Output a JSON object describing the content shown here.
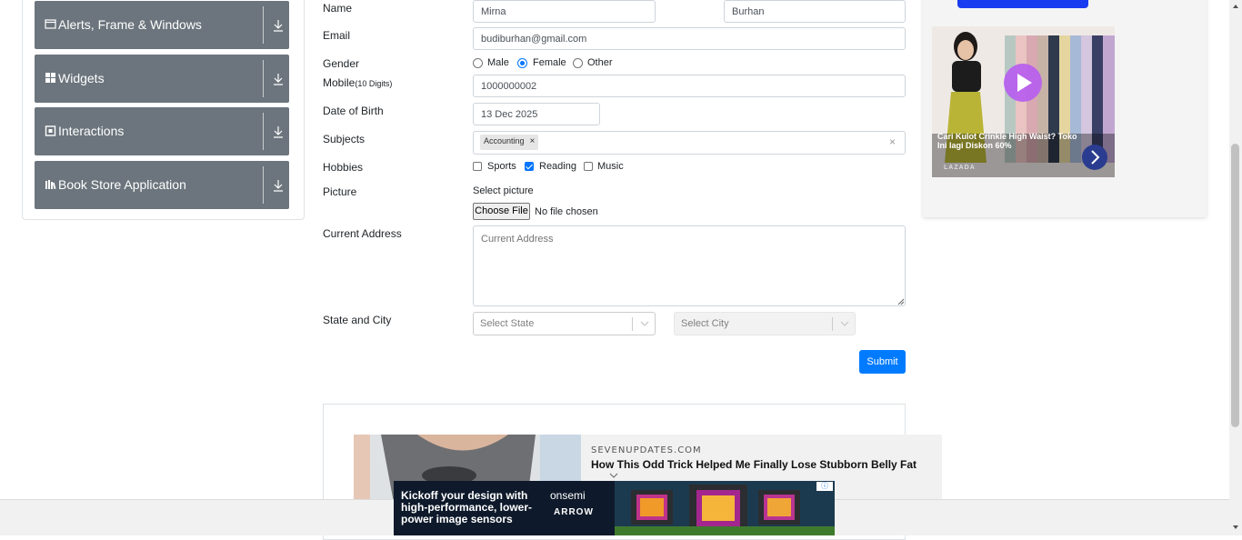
{
  "sidebar": {
    "groups": [
      {
        "label": "Alerts, Frame & Windows",
        "icon": "window-icon"
      },
      {
        "label": "Widgets",
        "icon": "grid-icon"
      },
      {
        "label": "Interactions",
        "icon": "square-icon"
      },
      {
        "label": "Book Store Application",
        "icon": "books-icon"
      }
    ]
  },
  "form": {
    "name_label": "Name",
    "first_name": "Mirna",
    "last_name": "Burhan",
    "email_label": "Email",
    "email": "budiburhan@gmail.com",
    "gender_label": "Gender",
    "gender_options": [
      "Male",
      "Female",
      "Other"
    ],
    "gender_selected": "Female",
    "mobile_label": "Mobile",
    "mobile_hint": "(10 Digits)",
    "mobile": "1000000002",
    "dob_label": "Date of Birth",
    "dob": "13 Dec 2025",
    "subjects_label": "Subjects",
    "subjects": [
      "Accounting"
    ],
    "subject_remove": "×",
    "subjects_clear": "×",
    "hobbies_label": "Hobbies",
    "hobbies": [
      {
        "label": "Sports",
        "checked": false
      },
      {
        "label": "Reading",
        "checked": true
      },
      {
        "label": "Music",
        "checked": false
      }
    ],
    "picture_label": "Picture",
    "picture_hint": "Select picture",
    "choose_file": "Choose File",
    "no_file": "No file chosen",
    "address_label": "Current Address",
    "address_placeholder": "Current Address",
    "state_city_label": "State and City",
    "state_placeholder": "Select State",
    "city_placeholder": "Select City",
    "submit": "Submit"
  },
  "ads": {
    "right": {
      "caption": "Cari Kulot Crinkle High Waist? Toko Ini lagi Diskon 60%",
      "brand": "LAZADA"
    },
    "promo": {
      "source": "SEVENUPDATES.COM",
      "headline": "How This Odd Trick Helped Me Finally Lose Stubborn Belly Fat"
    },
    "banner": {
      "text": "Kickoff your design with high-performance, lower-power image sensors",
      "brand": "onsemi",
      "partner": "ARROW"
    }
  },
  "colors": {
    "sidebar_header": "#6c757d",
    "primary": "#007bff",
    "accent_blue": "#0075ff"
  }
}
